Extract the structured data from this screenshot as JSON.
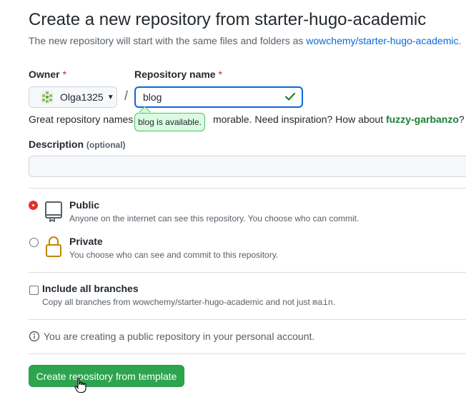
{
  "page": {
    "title": "Create a new repository from starter-hugo-academic",
    "subtitle_prefix": "The new repository will start with the same files and folders as ",
    "template_link": "wowchemy/starter-hugo-academic",
    "subtitle_suffix": "."
  },
  "owner": {
    "label": "Owner",
    "required_mark": "*",
    "value": "Olga1325"
  },
  "repo_name": {
    "label": "Repository name",
    "required_mark": "*",
    "value": "blog",
    "tooltip": "blog is available."
  },
  "hint": {
    "prefix": "Great repository names a",
    "middle": "morable. Need inspiration? How about ",
    "suggestion": "fuzzy-garbanzo",
    "suffix": "?"
  },
  "description": {
    "label": "Description",
    "optional": "(optional)",
    "value": ""
  },
  "visibility": {
    "public": {
      "title": "Public",
      "desc": "Anyone on the internet can see this repository. You choose who can commit.",
      "selected": true
    },
    "private": {
      "title": "Private",
      "desc": "You choose who can see and commit to this repository.",
      "selected": false
    }
  },
  "branches": {
    "title": "Include all branches",
    "desc_prefix": "Copy all branches from wowchemy/starter-hugo-academic and not just ",
    "desc_code": "main",
    "desc_suffix": ".",
    "checked": false
  },
  "info_text": "You are creating a public repository in your personal account.",
  "create_button": "Create repository from template",
  "colors": {
    "accent_blue": "#0969da",
    "success_green": "#2da44e",
    "radio_selected": "#e0342c"
  }
}
